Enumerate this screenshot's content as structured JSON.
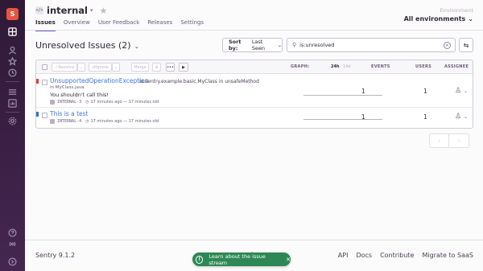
{
  "org": {
    "initial": "S"
  },
  "project": {
    "badge": "</>",
    "name": "internal"
  },
  "environment": {
    "label": "Environment",
    "value": "All environments"
  },
  "tabs": [
    "Issues",
    "Overview",
    "User Feedback",
    "Releases",
    "Settings"
  ],
  "issues_title": "Unresolved Issues (2)",
  "sort": {
    "prefix": "Sort by:",
    "value": "Last Seen"
  },
  "search": {
    "value": "is:unresolved"
  },
  "table_header": {
    "actions": [
      "Resolve",
      "Ignore",
      "Merge"
    ],
    "graph_label": "GRAPH:",
    "range_24h": "24h",
    "range_14d": "14d",
    "events_label": "EVENTS",
    "users_label": "USERS",
    "assignee_label": "ASSIGNEE"
  },
  "issues": [
    {
      "title": "UnsupportedOperationException",
      "culprit": "io.sentry.example.basic.MyClass in unsafeMethod",
      "location": "in MyClass.java",
      "message": "You shouldn't call this!",
      "short_id": "INTERNAL-3",
      "time": "17 minutes ago — 17 minutes old",
      "events": "1",
      "users": "1",
      "level_color": "#e03e2f"
    },
    {
      "title": "This is a test",
      "short_id": "INTERNAL-4",
      "time": "17 minutes ago — 17 minutes old",
      "events": "1",
      "users": "1",
      "level_color": "#3b6ecc"
    }
  ],
  "footer": {
    "version": "Sentry 9.1.2",
    "links": [
      "API",
      "Docs",
      "Contribute",
      "Migrate to SaaS"
    ]
  },
  "toast": {
    "text": "Learn about the issue stream"
  },
  "colors": {
    "sidebar": "#2f1937",
    "accent": "#6c5fc7",
    "link": "#3d74db",
    "toast": "#2e8855",
    "org_avatar": "#e6553d"
  }
}
